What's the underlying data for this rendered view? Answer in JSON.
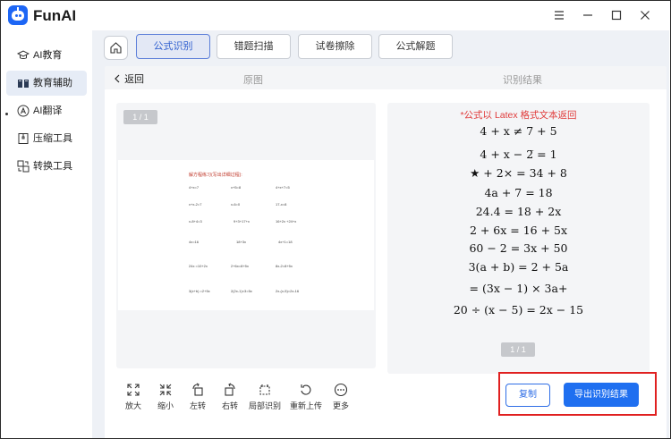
{
  "app": {
    "title": "FunAI"
  },
  "window": {
    "menu_icon": "menu-icon",
    "minimize_icon": "minimize-icon",
    "maximize_icon": "maximize-icon",
    "close_icon": "close-icon"
  },
  "sidebar": {
    "items": [
      {
        "label": "AI教育",
        "icon": "graduation-cap-icon"
      },
      {
        "label": "教育辅助",
        "icon": "book-icon",
        "active": true
      },
      {
        "label": "AI翻译",
        "icon": "translate-icon"
      },
      {
        "label": "压缩工具",
        "icon": "compress-icon"
      },
      {
        "label": "转换工具",
        "icon": "convert-icon"
      }
    ]
  },
  "tabs": [
    {
      "label": "公式识别",
      "active": true
    },
    {
      "label": "错题扫描"
    },
    {
      "label": "试卷擦除"
    },
    {
      "label": "公式解题"
    }
  ],
  "subbar": {
    "back_label": "返回",
    "original_label": "原图",
    "result_label": "识别结果"
  },
  "left_panel": {
    "page_indicator": "1 / 1",
    "document_title": "解方程练习(写出详细过程):",
    "equations": [
      "4+x=7",
      "x+5=8",
      "4+x+7=5",
      "x+x-2=7",
      "x-6=0",
      "17-x=8",
      "x-8+4=3",
      "9+3+17+x",
      "16+2x +24+x",
      "4x=16",
      "18+3x",
      "4x+1=18",
      "24x =10+2x",
      "2+6x=8+5x",
      "8x-2=8+5x",
      "3(x+b) =2+5x",
      "2(2x-1)×3=5x",
      "2x-(x-5)=2x-16"
    ]
  },
  "right_panel": {
    "note": "*公式以 Latex 格式文本返回",
    "formulas": [
      "4 + x ≠ 7 + 5",
      "4 + x − 2̅ = 1",
      "★ + 2× = 34 + 8",
      "4a + 7 = 18",
      "24.4 = 18 + 2x",
      "2 + 6x = 16 + 5x",
      "60 − 2 = 3x + 50",
      "3(a + b) = 2 + 5a",
      "= (3x − 1) × 3a+",
      "20 ÷ (x − 5) = 2x − 15"
    ],
    "page_indicator": "1 / 1"
  },
  "toolbar": {
    "items": [
      {
        "label": "放大",
        "icon": "expand-icon"
      },
      {
        "label": "缩小",
        "icon": "shrink-icon"
      },
      {
        "label": "左转",
        "icon": "rotate-left-icon"
      },
      {
        "label": "右转",
        "icon": "rotate-right-icon"
      },
      {
        "label": "局部识别",
        "icon": "crop-icon"
      },
      {
        "label": "重新上传",
        "icon": "reupload-icon"
      },
      {
        "label": "更多",
        "icon": "more-icon"
      }
    ]
  },
  "actions": {
    "copy_label": "复制",
    "export_label": "导出识别结果"
  },
  "colors": {
    "accent": "#1f6ff0",
    "note_red": "#e03b3b",
    "highlight_box": "#e02020",
    "active_tab_bg": "#e3e8f5",
    "sidebar_active_bg": "#e6ecf6"
  }
}
